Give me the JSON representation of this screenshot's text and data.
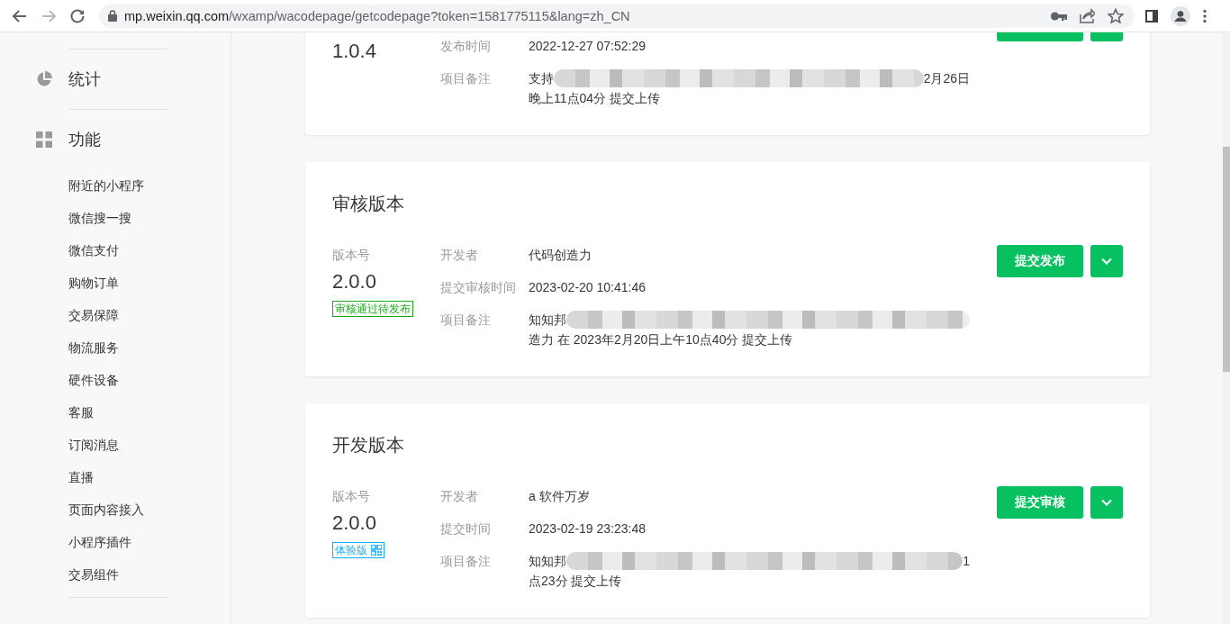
{
  "browser": {
    "forward_disabled": true,
    "address": {
      "host": "mp.weixin.qq.com",
      "path": "/wxamp/wacodepage/getcodepage?token=1581775115&lang=zh_CN"
    }
  },
  "sidebar": {
    "sections": [
      {
        "label": "统计",
        "kind": "pie"
      },
      {
        "label": "功能",
        "kind": "grid",
        "items": [
          "附近的小程序",
          "微信搜一搜",
          "微信支付",
          "购物订单",
          "交易保障",
          "物流服务",
          "硬件设备",
          "客服",
          "订阅消息",
          "直播",
          "页面内容接入",
          "小程序插件",
          "交易组件"
        ]
      }
    ]
  },
  "cards": [
    {
      "version": "1.0.4",
      "fields": [
        {
          "label": "发布时间",
          "value": "2022-12-27 07:52:29"
        },
        {
          "label": "项目备注",
          "lines": [
            {
              "kind": "redacted",
              "prefix": "支持",
              "suffix": "2月26日"
            },
            {
              "kind": "text",
              "text": "晚上11点04分 提交上传"
            }
          ]
        }
      ],
      "actions": [
        {
          "kind": "primary"
        },
        {
          "kind": "dropdown"
        }
      ]
    },
    {
      "title": "审核版本",
      "version_label": "版本号",
      "version": "2.0.0",
      "tag": {
        "kind": "review",
        "text": "审核通过待发布"
      },
      "fields": [
        {
          "label": "开发者",
          "value": "代码创造力"
        },
        {
          "label": "提交审核时间",
          "value": "2023-02-20 10:41:46"
        },
        {
          "label": "项目备注",
          "lines": [
            {
              "kind": "redacted",
              "prefix": "知知邦"
            },
            {
              "kind": "text",
              "text": "造力 在 2023年2月20日上午10点40分 提交上传"
            }
          ]
        }
      ],
      "actions": [
        {
          "kind": "primary",
          "label": "提交发布"
        },
        {
          "kind": "dropdown"
        }
      ]
    },
    {
      "title": "开发版本",
      "version_label": "版本号",
      "version": "2.0.0",
      "tag": {
        "kind": "trial",
        "text": "体验版"
      },
      "fields": [
        {
          "label": "开发者",
          "value": "a 软件万岁"
        },
        {
          "label": "提交时间",
          "value": "2023-02-19 23:23:48"
        },
        {
          "label": "项目备注",
          "lines": [
            {
              "kind": "redacted",
              "prefix": "知知邦",
              "suffix": "1"
            },
            {
              "kind": "text",
              "text": "点23分 提交上传"
            }
          ]
        }
      ],
      "actions": [
        {
          "kind": "primary",
          "label": "提交审核"
        },
        {
          "kind": "dropdown"
        }
      ]
    }
  ]
}
